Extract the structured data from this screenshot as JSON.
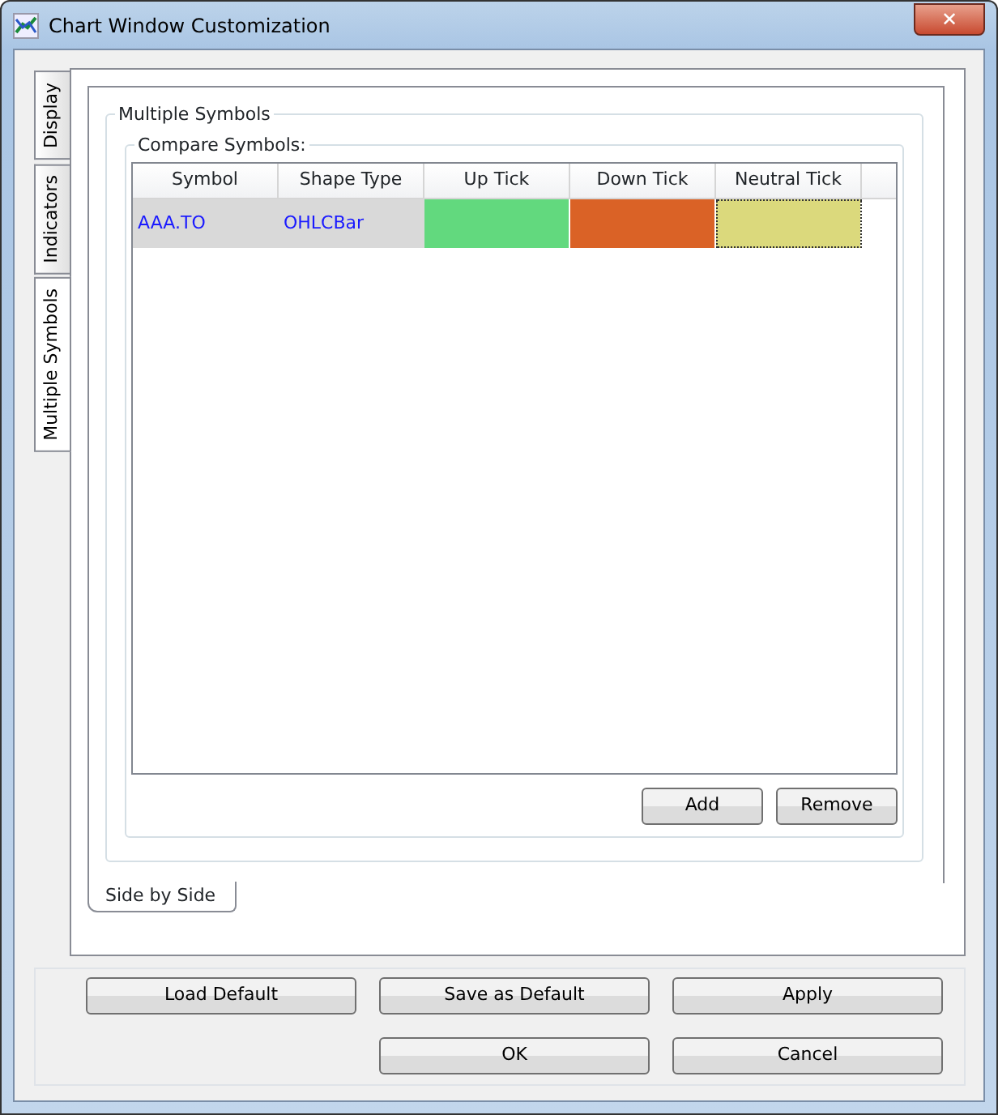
{
  "window": {
    "title": "Chart Window Customization",
    "close": "✕"
  },
  "side_tabs": [
    {
      "label": "Display",
      "selected": false
    },
    {
      "label": "Indicators",
      "selected": false
    },
    {
      "label": "Multiple Symbols",
      "selected": true
    }
  ],
  "group": {
    "title": "Multiple Symbols",
    "subgroup": "Compare Symbols:"
  },
  "table": {
    "columns": [
      "Symbol",
      "Shape Type",
      "Up Tick",
      "Down Tick",
      "Neutral Tick"
    ],
    "rows": [
      {
        "selected": true,
        "symbol": "AAA.TO",
        "shape_type": "OHLCBar",
        "ticks": [
          {
            "color": "#62d97e",
            "focused": false
          },
          {
            "color": "#da6226",
            "focused": false
          },
          {
            "color": "#dbd97c",
            "focused": true
          }
        ]
      }
    ]
  },
  "table_buttons": [
    "Add",
    "Remove"
  ],
  "bottom_tabs": [
    {
      "label": "Side by Side",
      "selected": true
    }
  ],
  "buttons": [
    "Load Default",
    "Save as Default",
    "Apply",
    "OK",
    "Cancel"
  ]
}
